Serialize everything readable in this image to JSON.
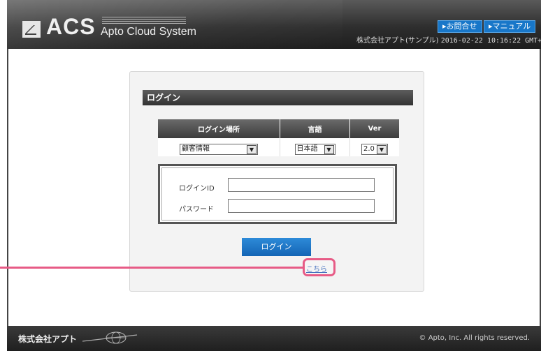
{
  "header": {
    "logo_text": "ACS",
    "logo_sub": "Apto Cloud System",
    "contact_button": "▸お問合せ",
    "manual_button": "▸マニュアル",
    "company": "株式会社アプト(サンプル)",
    "timestamp": "2016-02-22 10:16:22 GMT+09:00"
  },
  "login": {
    "title": "ログイン",
    "columns": {
      "location": "ログイン場所",
      "language": "言語",
      "version": "Ver"
    },
    "location_value": "顧客情報",
    "language_value": "日本語",
    "version_value": "2.0",
    "id_label": "ログインID",
    "password_label": "パスワード",
    "id_value": "",
    "password_value": "",
    "submit_label": "ログイン",
    "here_link": "こちら"
  },
  "footer": {
    "company": "株式会社アプト",
    "copyright": "© Apto, Inc. All rights reserved."
  },
  "colors": {
    "accent": "#1877c9",
    "highlight": "#e75b86"
  }
}
